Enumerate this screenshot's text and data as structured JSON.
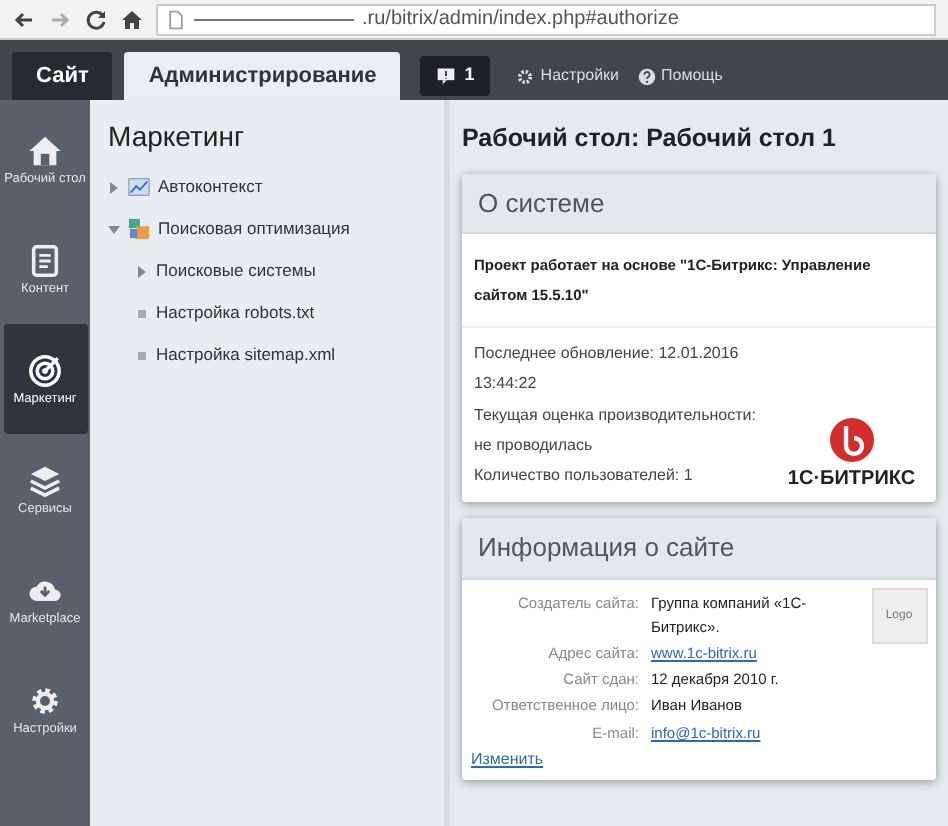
{
  "browser": {
    "url": ".ru/bitrix/admin/index.php#authorize"
  },
  "top_tabs": [
    {
      "label": "Сайт",
      "selected": false
    },
    {
      "label": "Администрирование",
      "selected": true
    }
  ],
  "notifications": {
    "count": "1"
  },
  "top_links": [
    {
      "label": "Настройки"
    },
    {
      "label": "Помощь"
    }
  ],
  "sidebar": {
    "items": [
      {
        "label": "Рабочий стол",
        "selected": false
      },
      {
        "label": "Контент",
        "selected": false
      },
      {
        "label": "Маркетинг",
        "selected": true
      },
      {
        "label": "Сервисы",
        "selected": false
      },
      {
        "label": "Marketplace",
        "selected": false
      },
      {
        "label": "Настройки",
        "selected": false
      }
    ]
  },
  "menu": {
    "title": "Маркетинг",
    "tree": [
      {
        "label": "Автоконтекст",
        "expanded": false
      },
      {
        "label": "Поисковая оптимизация",
        "expanded": true,
        "children": [
          {
            "label": "Поисковые системы",
            "expanded": false
          },
          {
            "label": "Настройка robots.txt"
          },
          {
            "label": "Настройка sitemap.xml"
          }
        ]
      }
    ]
  },
  "page_title": "Рабочий стол: Рабочий стол 1",
  "system_card": {
    "title": "О системе",
    "project": "Проект работает на основе \"1С-Битрикс: Управление сайтом 15.5.10\"",
    "lines": [
      "Последнее обновление: 12.01.2016 13:44:22",
      "Текущая оценка производительности: не проводилась",
      "Количество пользователей: 1"
    ],
    "logo_text": "1С·БИТРИКС"
  },
  "site_card": {
    "title": "Информация о сайте",
    "rows": [
      {
        "label": "Создатель сайта:",
        "value": "Группа компаний «1С-Битрикс».",
        "kind": "text"
      },
      {
        "label": "Адрес сайта:",
        "value": "www.1c-bitrix.ru",
        "kind": "link"
      },
      {
        "label": "Сайт сдан:",
        "value": "12 декабря 2010 г.",
        "kind": "text"
      },
      {
        "label": "Ответственное лицо:",
        "value": "Иван Иванов",
        "kind": "text"
      },
      {
        "label": "E-mail:",
        "value": "info@1c-bitrix.ru",
        "kind": "link"
      }
    ],
    "logo_placeholder": "Logo",
    "edit_link": "Изменить"
  }
}
